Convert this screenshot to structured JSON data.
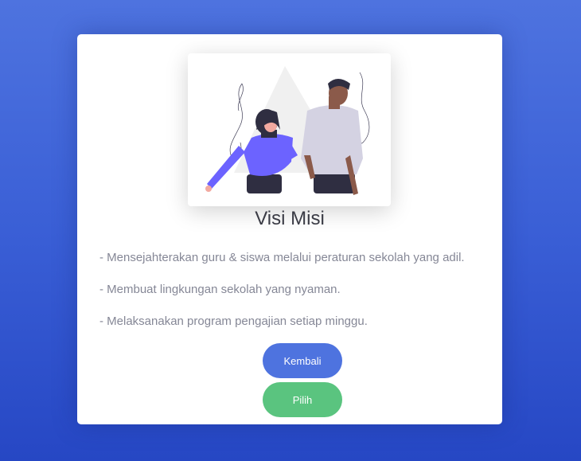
{
  "card": {
    "title": "Visi Misi",
    "missions": [
      "- Mensejahterakan guru & siswa melalui peraturan sekolah yang adil.",
      "- Membuat lingkungan sekolah yang nyaman.",
      "- Melaksanakan program pengajian setiap minggu."
    ],
    "buttons": {
      "back_label": "Kembali",
      "pick_label": "Pilih"
    }
  },
  "colors": {
    "background": "#4e73df",
    "primary_button": "#4e73df",
    "success_button": "#5ac47f",
    "text_muted": "#858796",
    "heading": "#3a3b45"
  },
  "illustration": {
    "icon": "people-illustration"
  }
}
